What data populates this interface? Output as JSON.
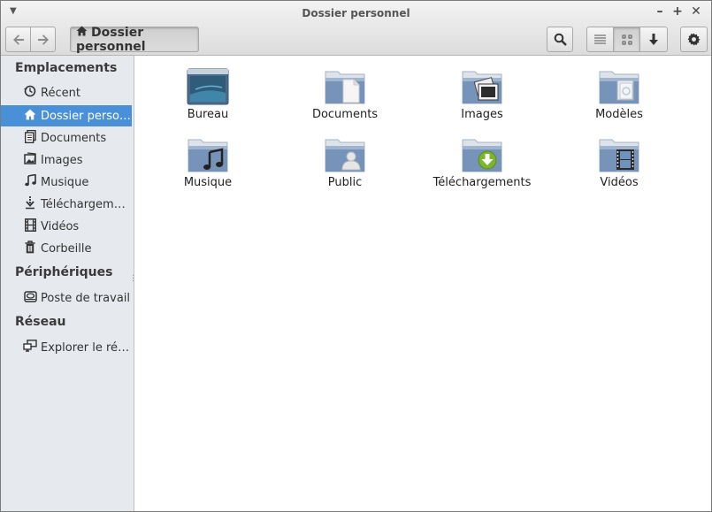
{
  "window": {
    "title": "Dossier personnel"
  },
  "toolbar": {
    "back_icon": "arrow-left-icon",
    "forward_icon": "arrow-right-icon",
    "breadcrumb": "Dossier personnel",
    "search_icon": "search-icon",
    "view_list_icon": "list-view-icon",
    "view_grid_icon": "grid-view-icon",
    "download_icon": "download-icon",
    "settings_icon": "gear-icon"
  },
  "sidebar": {
    "sections": [
      {
        "title": "Emplacements",
        "items": [
          {
            "label": "Récent",
            "icon": "clock-icon"
          },
          {
            "label": "Dossier person…",
            "icon": "home-icon",
            "selected": true
          },
          {
            "label": "Documents",
            "icon": "documents-icon"
          },
          {
            "label": "Images",
            "icon": "images-icon"
          },
          {
            "label": "Musique",
            "icon": "music-icon"
          },
          {
            "label": "Téléchargeme…",
            "icon": "download-icon"
          },
          {
            "label": "Vidéos",
            "icon": "film-icon"
          },
          {
            "label": "Corbeille",
            "icon": "trash-icon"
          }
        ]
      },
      {
        "title": "Périphériques",
        "items": [
          {
            "label": "Poste de travail",
            "icon": "drive-icon"
          }
        ]
      },
      {
        "title": "Réseau",
        "items": [
          {
            "label": "Explorer le rés…",
            "icon": "network-icon"
          }
        ]
      }
    ]
  },
  "files": [
    {
      "label": "Bureau",
      "icon": "desktop-folder-icon"
    },
    {
      "label": "Documents",
      "icon": "documents-folder-icon"
    },
    {
      "label": "Images",
      "icon": "images-folder-icon"
    },
    {
      "label": "Modèles",
      "icon": "templates-folder-icon"
    },
    {
      "label": "Musique",
      "icon": "music-folder-icon"
    },
    {
      "label": "Public",
      "icon": "public-folder-icon"
    },
    {
      "label": "Téléchargements",
      "icon": "downloads-folder-icon"
    },
    {
      "label": "Vidéos",
      "icon": "videos-folder-icon"
    }
  ],
  "colors": {
    "selection": "#4a90d9",
    "folder": "#6f93c0",
    "sidebar_bg": "#e6e9ee"
  }
}
